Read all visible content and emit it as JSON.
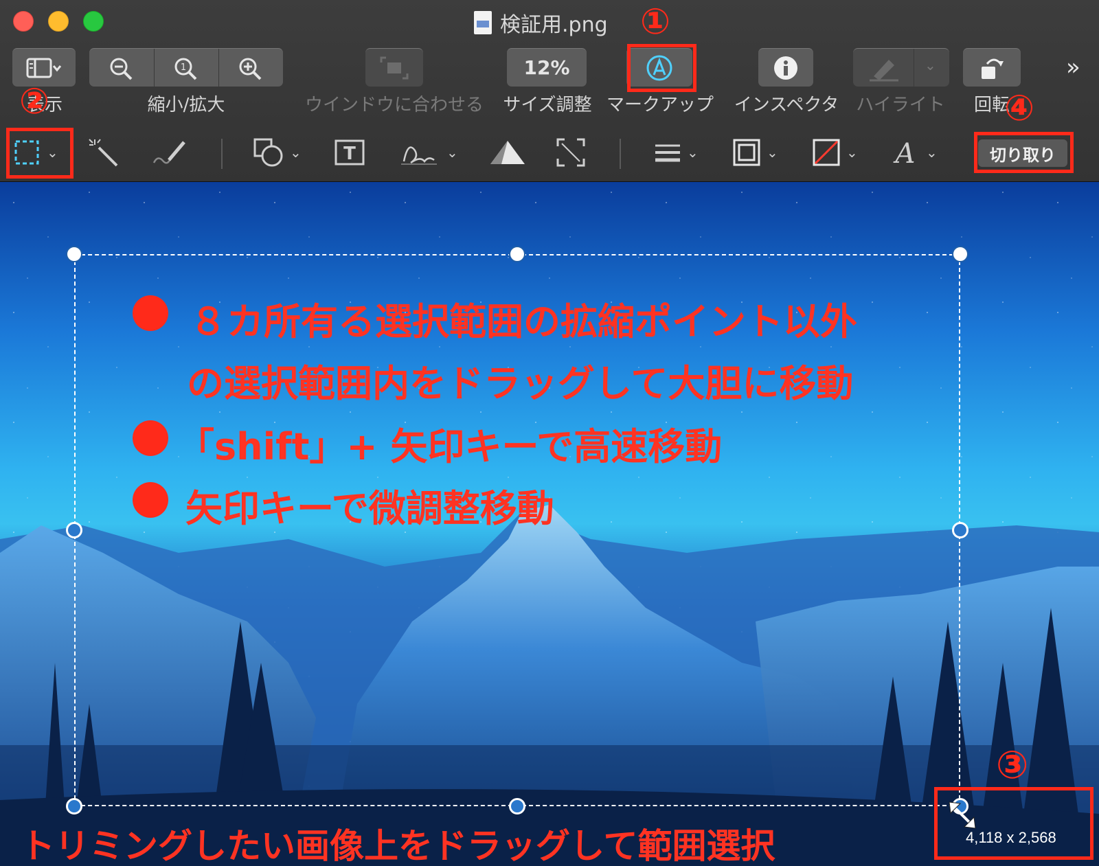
{
  "window": {
    "title": "検証用.png"
  },
  "toolbar": {
    "view_label": "表示",
    "zoom_label": "縮小/拡大",
    "fit_label": "ウインドウに合わせる",
    "zoom_level": "12%",
    "size_label": "サイズ調整",
    "markup_label": "マークアップ",
    "inspector_label": "インスペクタ",
    "highlight_label": "ハイライト",
    "rotate_label": "回転",
    "overflow": "»"
  },
  "markup_bar": {
    "crop_label": "切り取り"
  },
  "annotations": {
    "bullet1_line1": "８カ所有る選択範囲の拡縮ポイント以外",
    "bullet1_line2": "の選択範囲内をドラッグして大胆に移動",
    "bullet2": "「shift」+ 矢印キーで高速移動",
    "bullet3": "矢印キーで微調整移動",
    "bottom": "トリミングしたい画像上をドラッグして範囲選択",
    "num1": "①",
    "num2": "②",
    "num3": "③",
    "num4": "④"
  },
  "selection": {
    "dimensions": "4,118 x 2,568"
  },
  "icons": {
    "view": "sidebar-icon",
    "zoom_out": "zoom-out-icon",
    "actual_size": "actual-size-icon",
    "zoom_in": "zoom-in-icon",
    "fit": "fit-window-icon",
    "markup": "markup-pen-icon",
    "info": "info-icon",
    "highlight": "highlighter-icon",
    "rotate": "rotate-icon",
    "rect_select": "rectangular-selection-icon",
    "instant_alpha": "magic-wand-icon",
    "sketch": "sketch-pen-icon",
    "shapes": "shapes-icon",
    "text": "text-box-icon",
    "sign": "signature-icon",
    "adjust_color": "adjust-color-icon",
    "adjust_size": "adjust-size-icon",
    "shape_style": "line-style-icon",
    "border_color": "border-color-icon",
    "fill_color": "fill-color-icon",
    "text_style": "text-style-icon",
    "resize_cursor": "resize-cursor-icon"
  },
  "colors": {
    "annotation_red": "#ff2a1a",
    "markup_active": "#4fd1ff"
  }
}
